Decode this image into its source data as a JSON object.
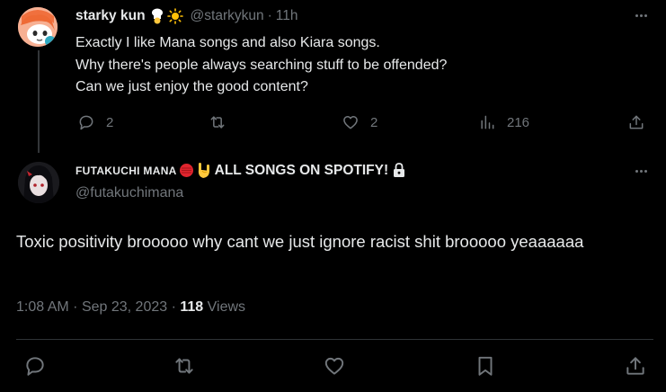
{
  "colors": {
    "background": "#000000",
    "text": "#e7e9ea",
    "muted": "#71767b",
    "divider": "#2f3336"
  },
  "reply_tweet": {
    "display_name": "starky kun",
    "emojis": [
      "chef-emoji",
      "sun-emoji"
    ],
    "handle": "@starkykun",
    "separator": "·",
    "time": "11h",
    "lines": [
      "Exactly I like Mana songs and also Kiara songs.",
      "Why there's people always searching stuff to be offended?",
      "Can we just enjoy the good content?"
    ],
    "actions": {
      "reply_count": "2",
      "repost_count": "",
      "like_count": "2",
      "views_count": "216"
    },
    "icons": [
      "reply-icon",
      "repost-icon",
      "like-icon",
      "views-icon",
      "share-icon",
      "more-icon"
    ]
  },
  "main_tweet": {
    "display_name_part1": "FUTAKUCHI MANA",
    "display_name_part2": "ALL SONGS ON SPOTIFY!",
    "name_emojis": [
      "red-circle-emoji",
      "rock-hand-emoji",
      "lock-emoji"
    ],
    "handle": "@futakuchimana",
    "text": "Toxic positivity brooooo why cant we just ignore racist shit brooooo yeaaaaaa",
    "time": "1:08 AM",
    "date_sep": "·",
    "date": "Sep 23, 2023",
    "views_sep": "·",
    "views_count": "118",
    "views_label": "Views",
    "icons": [
      "reply-icon",
      "repost-icon",
      "like-icon",
      "bookmark-icon",
      "share-icon",
      "more-icon"
    ]
  }
}
